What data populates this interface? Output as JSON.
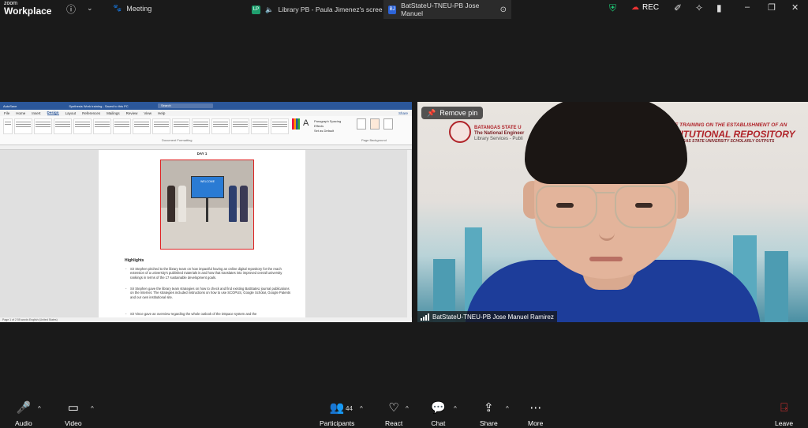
{
  "app": {
    "brand_top": "zoom",
    "brand_bottom": "Workplace",
    "meeting_label": "Meeting"
  },
  "tabs": [
    {
      "badge": "LP",
      "badge_color": "#1f9f6e",
      "label": "Library PB - Paula Jimenez's scree"
    },
    {
      "badge": "BJ",
      "badge_color": "#2d64d8",
      "label": "BatStateU-TNEU-PB Jose Manuel"
    }
  ],
  "recording": {
    "label": "REC"
  },
  "word": {
    "autosave": "AutoSave",
    "title": "Synthesis Work training - Saved to this PC",
    "search": "Search",
    "menu": [
      "File",
      "Home",
      "Insert",
      "Design",
      "Layout",
      "References",
      "Mailings",
      "Review",
      "View",
      "Help"
    ],
    "active_menu": "Design",
    "share": "Share",
    "ribbon_group_label": "Document Formatting",
    "ribbon_right_items": [
      "Paragraph Spacing",
      "Effects",
      "Set as Default"
    ],
    "page_bg_label": "Page Background",
    "day_heading": "DAY 1",
    "photo_banner": "WELCOME",
    "highlights_title": "Highlights",
    "bullets": [
      "Sir Stephen pitched to the library team on how impactful having an online digital repository for the reach extension of a university's published materials is and how that translates into improved overall university rankings in terms of the 17 sustainable development goals.",
      "Sir Stephen gave the library team strategies on how to check and find existing BatStateU journal publications on the Internet. The strategies included instructions on how to use SCOPUS, Google Scholar, Google Patents and our own institutional site.",
      "Sir Vince gave an overview regarding the whole outlook of the DSpace system and the"
    ],
    "status": "Page 1 of 2    55 words    English (United States)"
  },
  "video": {
    "pin_label": "Remove pin",
    "banner_line1": "E TRAINING ON THE ESTABLISHMENT OF AN",
    "banner_line2": "TITUTIONAL REPOSITORY",
    "banner_line3": "TANGAS STATE UNIVERSITY SCHOLARLY OUTPUTS",
    "org_line1": "BATANGAS STATE U",
    "org_line2": "The National Engineer",
    "org_line3": "Library Services - Publi",
    "participant_name": "BatStateU-TNEU-PB Jose Manuel Ramirez"
  },
  "controls": {
    "audio": "Audio",
    "video": "Video",
    "participants": "Participants",
    "participants_count": "44",
    "react": "React",
    "chat": "Chat",
    "share": "Share",
    "more": "More",
    "leave": "Leave"
  }
}
